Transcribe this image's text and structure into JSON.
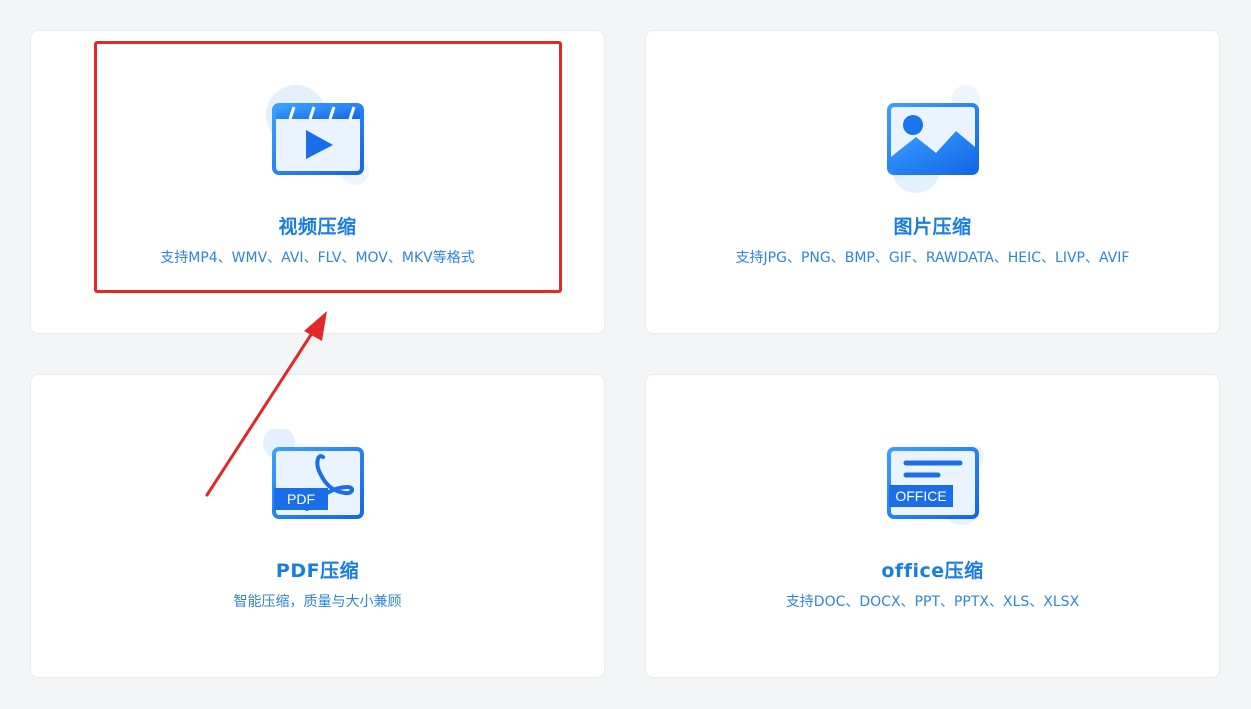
{
  "cards": [
    {
      "id": "video",
      "title": "视频压缩",
      "desc": "支持MP4、WMV、AVI、FLV、MOV、MKV等格式",
      "icon": "video-icon"
    },
    {
      "id": "image",
      "title": "图片压缩",
      "desc": "支持JPG、PNG、BMP、GIF、RAWDATA、HEIC、LIVP、AVIF",
      "icon": "image-icon"
    },
    {
      "id": "pdf",
      "title": "PDF压缩",
      "desc": "智能压缩，质量与大小兼顾",
      "icon": "pdf-icon",
      "icon_text": "PDF"
    },
    {
      "id": "office",
      "title": "office压缩",
      "desc": "支持DOC、DOCX、PPT、PPTX、XLS、XLSX",
      "icon": "office-icon",
      "icon_text": "OFFICE"
    }
  ],
  "colors": {
    "accent": "#1a7de0",
    "desc": "#2d86d8",
    "annotation": "#e02a2a",
    "background": "#f3f5f7"
  }
}
